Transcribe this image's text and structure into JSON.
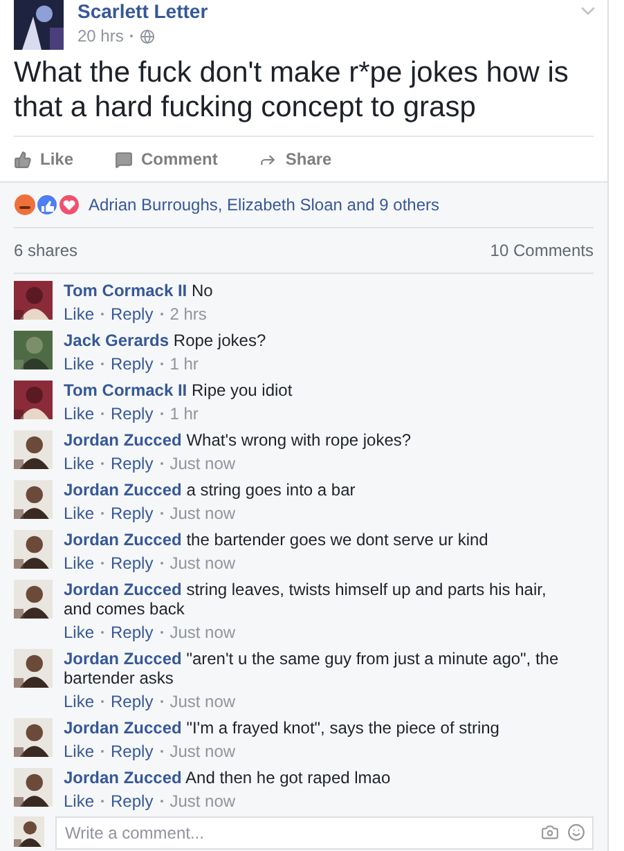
{
  "post": {
    "author": "Scarlett Letter",
    "time": "20 hrs",
    "text": "What the fuck don't make r*pe jokes how is that a hard fucking concept to grasp"
  },
  "actions": [
    {
      "kind": "like",
      "label": "Like"
    },
    {
      "kind": "comment",
      "label": "Comment"
    },
    {
      "kind": "share",
      "label": "Share"
    }
  ],
  "reactions": {
    "summary": "Adrian Burroughs, Elizabeth Sloan and 9 others"
  },
  "shares": "6 shares",
  "comment_count": "10 Comments",
  "comments": [
    {
      "author": "Tom Cormack II",
      "text": "No",
      "like": "Like",
      "reply": "Reply",
      "time": "2 hrs"
    },
    {
      "author": "Jack Gerards",
      "text": "Rope jokes?",
      "like": "Like",
      "reply": "Reply",
      "time": "1 hr"
    },
    {
      "author": "Tom Cormack II",
      "text": "Ripe you idiot",
      "like": "Like",
      "reply": "Reply",
      "time": "1 hr"
    },
    {
      "author": "Jordan Zucced",
      "text": "What's wrong with rope jokes?",
      "like": "Like",
      "reply": "Reply",
      "time": "Just now"
    },
    {
      "author": "Jordan Zucced",
      "text": "a string goes into a bar",
      "like": "Like",
      "reply": "Reply",
      "time": "Just now"
    },
    {
      "author": "Jordan Zucced",
      "text": "the bartender goes we dont serve ur kind",
      "like": "Like",
      "reply": "Reply",
      "time": "Just now"
    },
    {
      "author": "Jordan Zucced",
      "text": "string leaves, twists himself up and parts his hair, and comes back",
      "like": "Like",
      "reply": "Reply",
      "time": "Just now"
    },
    {
      "author": "Jordan Zucced",
      "text": "\"aren't u the same guy from just a minute ago\", the bartender asks",
      "like": "Like",
      "reply": "Reply",
      "time": "Just now"
    },
    {
      "author": "Jordan Zucced",
      "text": "\"I'm a frayed knot\", says the piece of string",
      "like": "Like",
      "reply": "Reply",
      "time": "Just now"
    },
    {
      "author": "Jordan Zucced",
      "text": "And then he got raped lmao",
      "like": "Like",
      "reply": "Reply",
      "time": "Just now"
    }
  ],
  "composer": {
    "placeholder": "Write a comment..."
  }
}
